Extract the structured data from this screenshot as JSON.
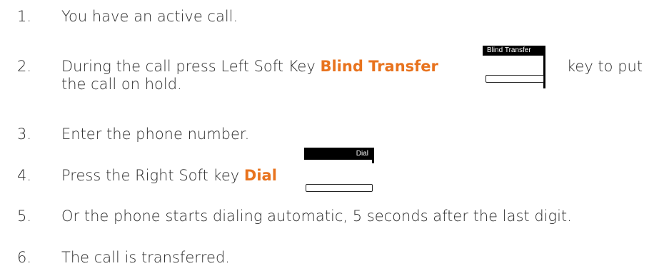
{
  "steps": [
    {
      "number": "1.",
      "text": "You have an active call."
    },
    {
      "number": "2.",
      "text_before": "During the call press Left Soft Key ",
      "highlight": "Blind Transfer",
      "text_after": "key to put",
      "text_line2": "the call on hold.",
      "softkey_label": "Blind Transfer"
    },
    {
      "number": "3.",
      "text": "Enter the phone number."
    },
    {
      "number": "4.",
      "text_before": "Press the Right Soft key ",
      "highlight": "Dial",
      "softkey_label": "Dial"
    },
    {
      "number": "5.",
      "text": "Or the phone starts dialing automatic, 5 seconds after the last digit."
    },
    {
      "number": "6.",
      "text": "The call is transferred."
    }
  ],
  "colors": {
    "text": "#2b2b2b",
    "highlight": "#e8731e",
    "softkey_bar": "#000000"
  }
}
